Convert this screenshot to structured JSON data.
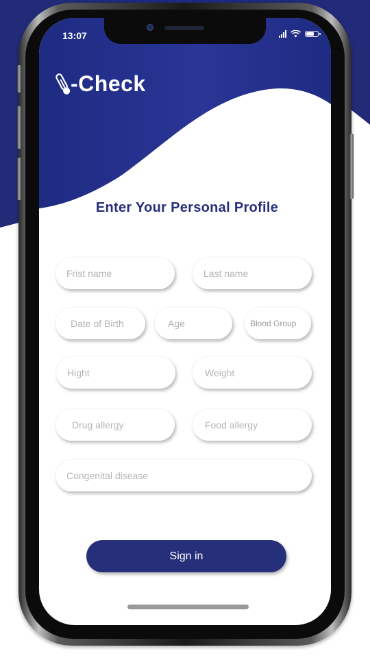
{
  "status_bar": {
    "time": "13:07",
    "battery_percent": 80
  },
  "app": {
    "logo_text": "-Check",
    "logo_icon": "thermometer-icon"
  },
  "title": "Enter Your Personal Profile",
  "fields": {
    "first_name": {
      "placeholder": "Frist name",
      "value": ""
    },
    "last_name": {
      "placeholder": "Last name",
      "value": ""
    },
    "date_of_birth": {
      "placeholder": "Date of Birth",
      "value": ""
    },
    "age": {
      "placeholder": "Age",
      "value": ""
    },
    "blood_group": {
      "placeholder": "Blood Group",
      "value": ""
    },
    "height": {
      "placeholder": "Hight",
      "value": ""
    },
    "weight": {
      "placeholder": "Weight",
      "value": ""
    },
    "drug_allergy": {
      "placeholder": "Drug allergy",
      "value": ""
    },
    "food_allergy": {
      "placeholder": "Food allergy",
      "value": ""
    },
    "congenital_disease": {
      "placeholder": "Congenital disease",
      "value": ""
    }
  },
  "sign_in_label": "Sign in",
  "colors": {
    "brand": "#262f7a",
    "header_bg": "#1f2a7a",
    "background": "#ffffff"
  }
}
